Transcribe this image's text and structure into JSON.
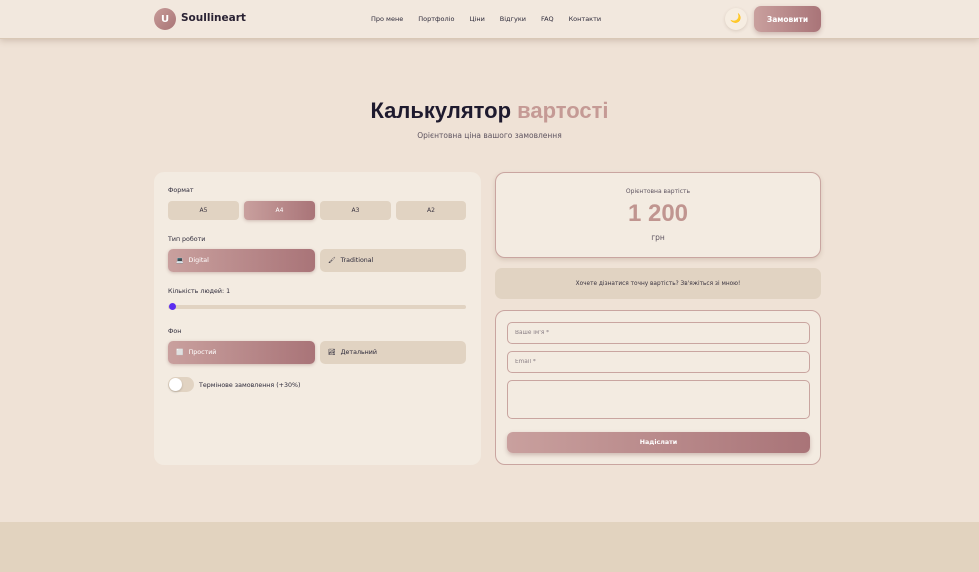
{
  "header": {
    "logo_letter": "U",
    "brand": "Soullineart",
    "nav": [
      "Про мене",
      "Портфоліо",
      "Ціни",
      "Відгуки",
      "FAQ",
      "Контакти"
    ],
    "theme_icon": "moon-icon",
    "order_label": "Замовити"
  },
  "hero": {
    "title_main": "Калькулятор",
    "title_accent": "вартості",
    "subtitle": "Орієнтовна ціна вашого замовлення"
  },
  "calculator": {
    "format_label": "Формат",
    "formats": [
      "А5",
      "А4",
      "А3",
      "А2"
    ],
    "format_selected": "А4",
    "work_type_label": "Тип роботи",
    "work_types": [
      {
        "label": "Digital",
        "icon": "laptop-icon",
        "glyph": "💻"
      },
      {
        "label": "Traditional",
        "icon": "brush-icon",
        "glyph": "🖌"
      }
    ],
    "work_type_selected": "Digital",
    "people_label": "Кількість людей: 1",
    "people_count": 1,
    "background_label": "Фон",
    "backgrounds": [
      {
        "label": "Простий",
        "icon": "white-square-icon",
        "glyph": "⬜"
      },
      {
        "label": "Детальний",
        "icon": "landscape-icon",
        "glyph": "🏞"
      }
    ],
    "background_selected": "Простий",
    "urgent_label": "Термінове замовлення (+30%)",
    "urgent_on": false
  },
  "price": {
    "label": "Орієнтовна вартість",
    "value": "1 200",
    "unit": "грн"
  },
  "exact_note": "Хочете дізнатися точну вартість? Зв'яжіться зі мною!",
  "form": {
    "name_placeholder": "Ваше ім'я *",
    "email_placeholder": "Email *",
    "message_placeholder": "",
    "submit_label": "Надіслати"
  },
  "colors": {
    "accent": "#c59a95",
    "gradient_start": "#c9a09e",
    "gradient_end": "#a97478",
    "background": "#efe2d6",
    "slider_thumb": "#5b2df0"
  }
}
